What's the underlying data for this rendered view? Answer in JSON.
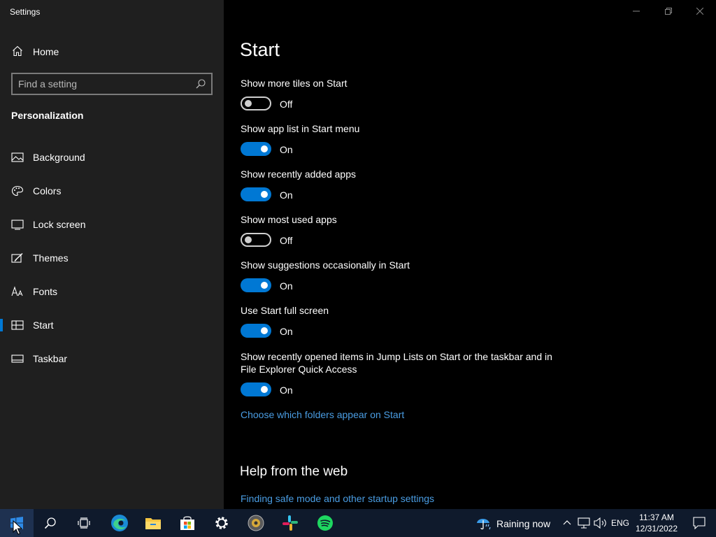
{
  "app": {
    "title": "Settings"
  },
  "sidebar": {
    "home_label": "Home",
    "search_placeholder": "Find a setting",
    "section_label": "Personalization",
    "items": [
      {
        "label": "Background",
        "icon": "picture-icon"
      },
      {
        "label": "Colors",
        "icon": "palette-icon"
      },
      {
        "label": "Lock screen",
        "icon": "monitor-icon"
      },
      {
        "label": "Themes",
        "icon": "themes-icon"
      },
      {
        "label": "Fonts",
        "icon": "font-icon"
      },
      {
        "label": "Start",
        "icon": "start-layout-icon",
        "active": true
      },
      {
        "label": "Taskbar",
        "icon": "taskbar-icon"
      }
    ]
  },
  "main": {
    "title": "Start",
    "settings": [
      {
        "label": "Show more tiles on Start",
        "on": false,
        "state": "Off"
      },
      {
        "label": "Show app list in Start menu",
        "on": true,
        "state": "On"
      },
      {
        "label": "Show recently added apps",
        "on": true,
        "state": "On"
      },
      {
        "label": "Show most used apps",
        "on": false,
        "state": "Off"
      },
      {
        "label": "Show suggestions occasionally in Start",
        "on": true,
        "state": "On"
      },
      {
        "label": "Use Start full screen",
        "on": true,
        "state": "On"
      },
      {
        "label": "Show recently opened items in Jump Lists on Start or the taskbar and in File Explorer Quick Access",
        "on": true,
        "state": "On"
      }
    ],
    "folders_link": "Choose which folders appear on Start",
    "help_title": "Help from the web",
    "help_link": "Finding safe mode and other startup settings"
  },
  "taskbar": {
    "apps": [
      "windows-start-icon",
      "search-icon",
      "task-view-icon",
      "edge-icon",
      "file-explorer-icon",
      "store-icon",
      "settings-gear-icon",
      "app-icon",
      "slack-icon",
      "spotify-icon"
    ],
    "weather_text": "Raining now",
    "language": "ENG",
    "time": "11:37 AM",
    "date": "12/31/2022"
  },
  "colors": {
    "accent": "#0078d4",
    "link": "#4a9de3",
    "sidebar_bg": "#1f1f1f",
    "taskbar_bg": "#0f1a2c"
  }
}
